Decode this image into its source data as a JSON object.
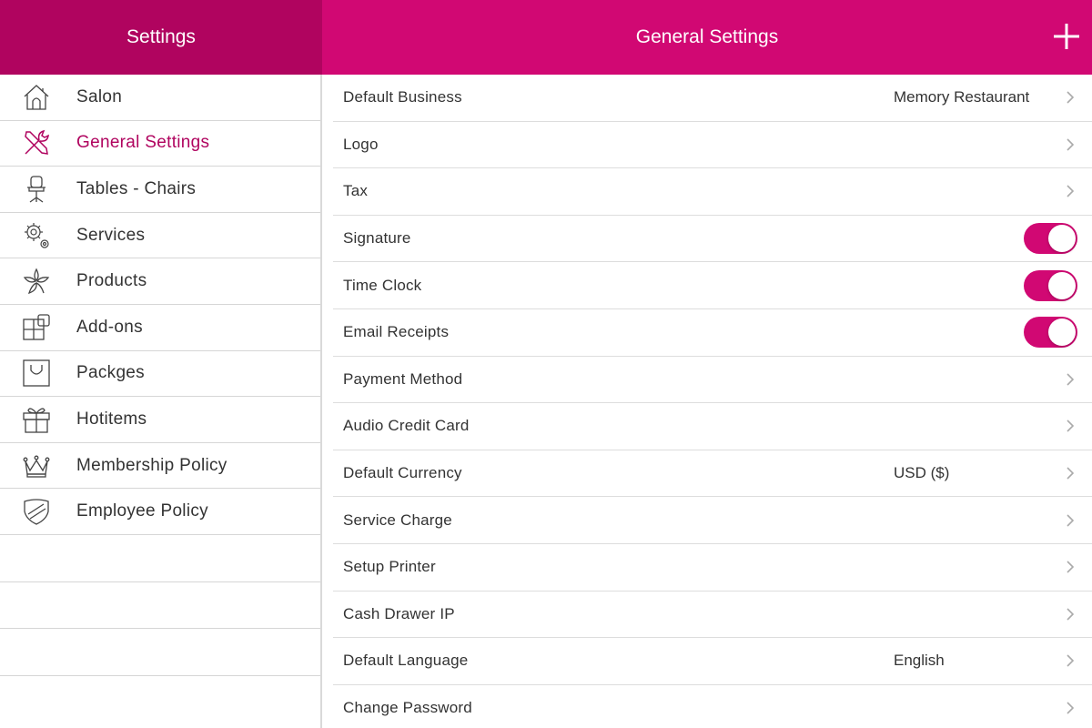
{
  "sidebar": {
    "title": "Settings",
    "items": [
      {
        "label": "Salon",
        "icon": "house-icon",
        "active": false
      },
      {
        "label": "General Settings",
        "icon": "wrench-screwdriver-icon",
        "active": true
      },
      {
        "label": "Tables - Chairs",
        "icon": "chair-icon",
        "active": false
      },
      {
        "label": "Services",
        "icon": "gears-icon",
        "active": false
      },
      {
        "label": "Products",
        "icon": "flower-icon",
        "active": false
      },
      {
        "label": "Add-ons",
        "icon": "blocks-icon",
        "active": false
      },
      {
        "label": "Packges",
        "icon": "bag-icon",
        "active": false
      },
      {
        "label": "Hotitems",
        "icon": "gift-icon",
        "active": false
      },
      {
        "label": "Membership Policy",
        "icon": "crown-icon",
        "active": false
      },
      {
        "label": "Employee Policy",
        "icon": "shield-icon",
        "active": false
      }
    ]
  },
  "main": {
    "title": "General Settings",
    "add_icon": "plus-icon",
    "rows": [
      {
        "label": "Default Business",
        "value": "Memory Restaurant",
        "type": "link"
      },
      {
        "label": "Logo",
        "value": "",
        "type": "link"
      },
      {
        "label": "Tax",
        "value": "",
        "type": "link"
      },
      {
        "label": "Signature",
        "value": "",
        "type": "toggle",
        "on": true
      },
      {
        "label": "Time Clock",
        "value": "",
        "type": "toggle",
        "on": true
      },
      {
        "label": "Email Receipts",
        "value": "",
        "type": "toggle",
        "on": true
      },
      {
        "label": "Payment Method",
        "value": "",
        "type": "link"
      },
      {
        "label": "Audio Credit Card",
        "value": "",
        "type": "link"
      },
      {
        "label": "Default Currency",
        "value": "USD ($)",
        "type": "link"
      },
      {
        "label": "Service Charge",
        "value": "",
        "type": "link"
      },
      {
        "label": "Setup Printer",
        "value": "",
        "type": "link"
      },
      {
        "label": "Cash Drawer IP",
        "value": "",
        "type": "link"
      },
      {
        "label": "Default Language",
        "value": "English",
        "type": "link"
      },
      {
        "label": "Change Password",
        "value": "",
        "type": "link"
      }
    ]
  },
  "colors": {
    "sidebar_header": "#b0045f",
    "main_header": "#d10873",
    "accent": "#d10873",
    "active_text": "#b0045f"
  }
}
